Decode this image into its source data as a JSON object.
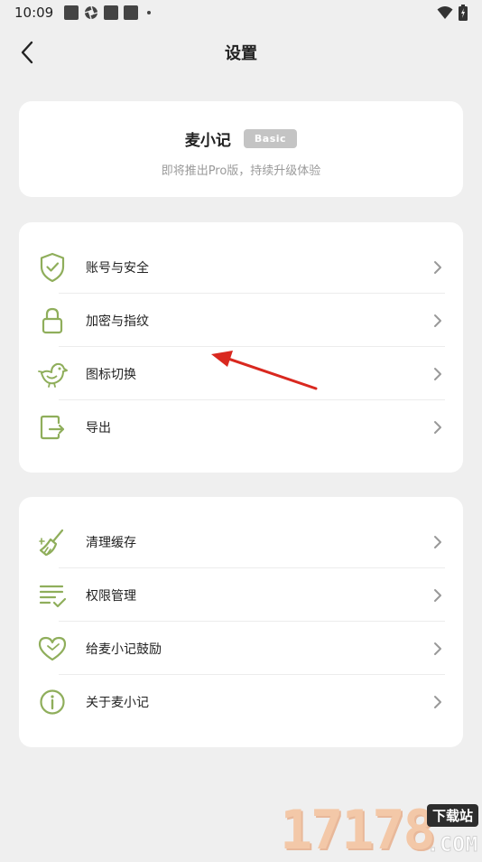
{
  "status_bar": {
    "time": "10:09",
    "icons": [
      "notification-square-icon",
      "aperture-icon",
      "notification-square-icon",
      "notification-square-icon",
      "dot-icon"
    ],
    "right_icons": [
      "wifi-icon",
      "battery-charging-icon"
    ]
  },
  "header": {
    "title": "设置",
    "back_icon": "chevron-left-icon"
  },
  "profile": {
    "app_name": "麦小记",
    "plan_badge": "Basic",
    "subtitle": "即将推出Pro版，持续升级体验"
  },
  "group1": {
    "items": [
      {
        "label": "账号与安全",
        "icon": "shield-check-icon"
      },
      {
        "label": "加密与指纹",
        "icon": "lock-icon"
      },
      {
        "label": "图标切换",
        "icon": "bird-icon"
      },
      {
        "label": "导出",
        "icon": "export-icon"
      }
    ]
  },
  "group2": {
    "items": [
      {
        "label": "清理缓存",
        "icon": "broom-icon"
      },
      {
        "label": "权限管理",
        "icon": "list-check-icon"
      },
      {
        "label": "给麦小记鼓励",
        "icon": "heart-icon"
      },
      {
        "label": "关于麦小记",
        "icon": "info-icon"
      }
    ]
  },
  "colors": {
    "accent": "#8fae5b",
    "background": "#efefef",
    "card": "#ffffff",
    "badge": "#c4c4c4",
    "annotation_arrow": "#d9281f"
  },
  "watermark": {
    "digits": "17178",
    "badge": "下载站",
    "domain": ".COM"
  }
}
